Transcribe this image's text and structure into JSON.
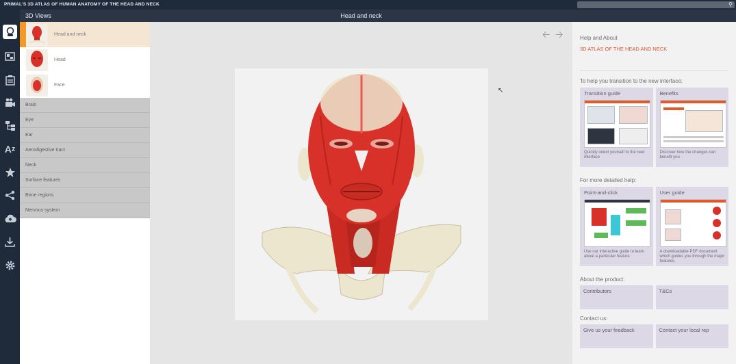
{
  "app": {
    "title": "PRIMAL'S 3D ATLAS OF HUMAN ANATOMY OF THE HEAD AND NECK"
  },
  "search": {
    "icon": "search-icon"
  },
  "iconbar": {
    "icons": [
      "3d-views-icon",
      "slides-icon",
      "quiz-icon",
      "movies-icon",
      "hierarchy-icon",
      "a-z-index-icon",
      "favorites-icon",
      "share-icon",
      "cloud-icon",
      "download-icon",
      "settings-icon"
    ]
  },
  "left_panel": {
    "header": "3D Views",
    "thumb_items": [
      {
        "label": "Head and neck",
        "active": true
      },
      {
        "label": "Head",
        "active": false
      },
      {
        "label": "Face",
        "active": false
      }
    ],
    "categories": [
      "Brain",
      "Eye",
      "Ear",
      "Aerodigestive tract",
      "Neck",
      "Surface features",
      "Bone regions",
      "Nervous system"
    ]
  },
  "viewer": {
    "header": "Head and neck",
    "back_icon": "arrow-left-icon",
    "forward_icon": "arrow-right-icon"
  },
  "right_panel": {
    "help_about": "Help and About",
    "atlas_title": "3D ATLAS OF THE HEAD AND NECK",
    "transition_heading": "To help you transition to the new interface:",
    "transition_cards": [
      {
        "title": "Transition guide",
        "desc": "Quickly orient yourself to the new interface"
      },
      {
        "title": "Benefits",
        "desc": "Discover how the changes can benefit you"
      }
    ],
    "detailed_heading": "For more detailed help:",
    "detailed_cards": [
      {
        "title": "Point-and-click",
        "desc": "Use our interactive guide to learn about a particular feature"
      },
      {
        "title": "User guide",
        "desc": "A downloadable PDF document which guides you through the major features."
      }
    ],
    "product_heading": "About the product:",
    "product_buttons": [
      "Contributors",
      "T&Cs"
    ],
    "contact_heading": "Contact us:",
    "contact_buttons": [
      "Give us your feedback",
      "Contact your local rep"
    ]
  },
  "colors": {
    "active_accent": "#f39a26",
    "atlas_red": "#e0562e",
    "muscle_red": "#d8312a",
    "bone": "#ece6cf"
  }
}
